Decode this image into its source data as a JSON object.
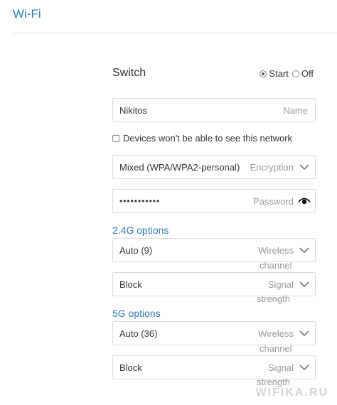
{
  "header": {
    "title": "Wi-Fi"
  },
  "switch": {
    "label": "Switch",
    "options": [
      "Start",
      "Off"
    ],
    "selected": "Start"
  },
  "name_field": {
    "value": "Nikitos",
    "hint": "Name"
  },
  "hide_network": {
    "label": "Devices won't be able to see this network",
    "checked": false
  },
  "encryption_field": {
    "value": "Mixed (WPA/WPA2-personal)",
    "hint": "Encryption"
  },
  "password_field": {
    "value": "•••••••••••",
    "hint": "Password"
  },
  "band_24": {
    "title": "2.4G options",
    "channel": {
      "value": "Auto (9)",
      "hint_line1": "Wireless",
      "hint_line2": "channel"
    },
    "signal": {
      "value": "Block",
      "hint_line1": "Signal",
      "hint_line2": "strength"
    }
  },
  "band_5": {
    "title": "5G options",
    "channel": {
      "value": "Auto (36)",
      "hint_line1": "Wireless",
      "hint_line2": "channel"
    },
    "signal": {
      "value": "Block",
      "hint_line1": "Signal",
      "hint_line2": "strength"
    }
  },
  "watermark": "WIFIKA.RU",
  "colors": {
    "accent": "#2a7fb0",
    "border": "#dcdcdc",
    "hint": "#999999"
  },
  "icons": [
    "chevron-down-icon",
    "eye-icon",
    "radio-icon",
    "checkbox-icon"
  ]
}
